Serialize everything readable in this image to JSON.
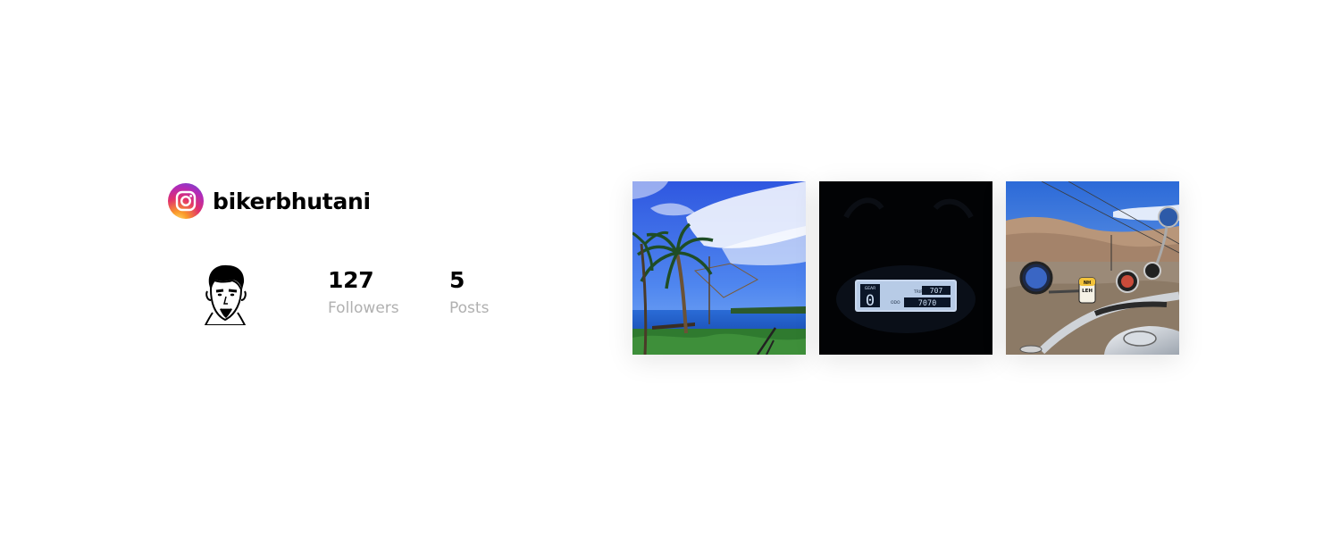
{
  "profile": {
    "handle": "bikerbhutani",
    "icon": "instagram-icon",
    "avatar": "avatar-illustration"
  },
  "stats": {
    "followers": {
      "value": "127",
      "label": "Followers"
    },
    "posts": {
      "value": "5",
      "label": "Posts"
    }
  },
  "gallery": {
    "posts": [
      {
        "subject": "palm-trees-lake-fishing-nets"
      },
      {
        "subject": "motorcycle-lcd-dashboard-at-night"
      },
      {
        "subject": "motorcycle-handlebar-mountain-road-leh"
      }
    ]
  },
  "dashboard_photo": {
    "gear_label": "GEAR",
    "gear_value": "0",
    "trip_label": "TRIP",
    "trip_value": "707",
    "odo_label": "ODO",
    "odo_value": "7070"
  },
  "road_photo": {
    "milestone_line1": "NH",
    "milestone_line2": "LEH"
  },
  "colors": {
    "text_primary": "#000000",
    "text_secondary": "#b0b0b0",
    "ig_gradient": [
      "#feda75",
      "#fa7e1e",
      "#d62976",
      "#962fbf",
      "#4f5bd5"
    ]
  }
}
